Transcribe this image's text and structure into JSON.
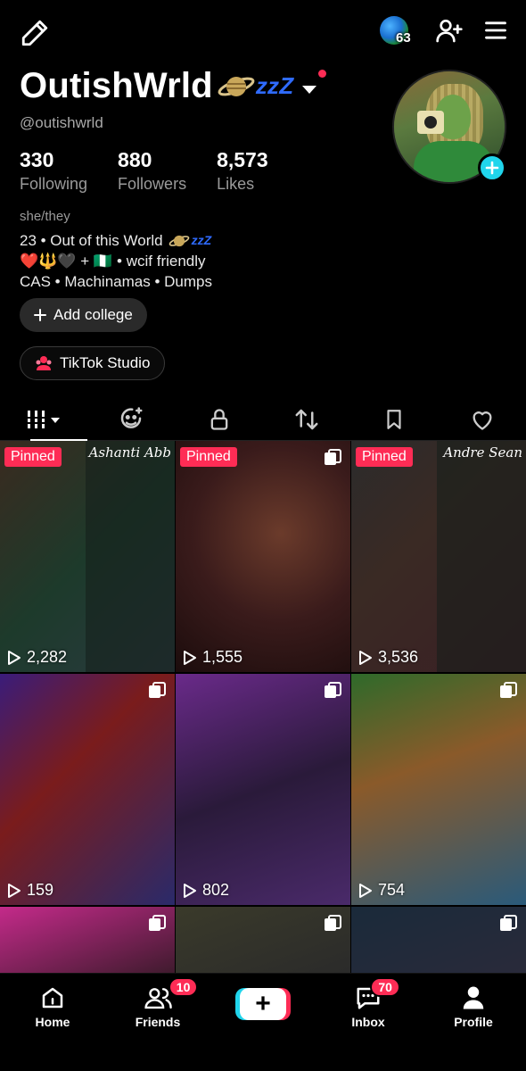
{
  "header": {
    "badge_count": "63",
    "display_name": "OutishWrld",
    "name_deco_zzz": "zzZ",
    "handle": "@outishwrld"
  },
  "stats": [
    {
      "value": "330",
      "label": "Following"
    },
    {
      "value": "880",
      "label": "Followers"
    },
    {
      "value": "8,573",
      "label": "Likes"
    }
  ],
  "bio": {
    "pronouns": "she/they",
    "line1_text": "23 • Out of this World",
    "line1_zzz": "zzZ",
    "line2_emojis": "❤️🔱🖤 + 🇳🇬",
    "line2_text": "• wcif friendly",
    "line3": "CAS • Machinamas • Dumps"
  },
  "buttons": {
    "add_college": "Add college",
    "tiktok_studio": "TikTok Studio"
  },
  "tabs": [
    {
      "icon": "grid-icon",
      "active": true
    },
    {
      "icon": "reposts-face-icon"
    },
    {
      "icon": "lock-icon"
    },
    {
      "icon": "repost-icon"
    },
    {
      "icon": "bookmark-icon"
    },
    {
      "icon": "heart-icon"
    }
  ],
  "videos": [
    {
      "pinned": "Pinned",
      "views": "2,282",
      "card_title": "Ashanti Abb"
    },
    {
      "pinned": "Pinned",
      "views": "1,555",
      "multi": true
    },
    {
      "pinned": "Pinned",
      "views": "3,536",
      "card_title": "Andre Sean"
    },
    {
      "views": "159",
      "multi": true
    },
    {
      "views": "802",
      "multi": true
    },
    {
      "views": "754",
      "multi": true
    },
    {
      "views": "",
      "multi": true
    },
    {
      "views": "",
      "multi": true
    },
    {
      "views": "",
      "multi": true
    }
  ],
  "bottom_nav": {
    "home": "Home",
    "friends": "Friends",
    "friends_badge": "10",
    "inbox": "Inbox",
    "inbox_badge": "70",
    "profile": "Profile"
  },
  "colors": {
    "accent_red": "#fe2c55",
    "accent_cyan": "#20d5ec"
  }
}
